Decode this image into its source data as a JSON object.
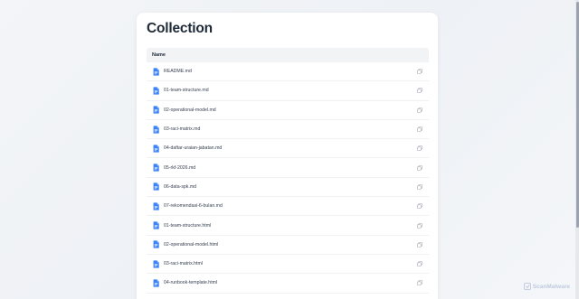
{
  "page": {
    "title": "Collection"
  },
  "table": {
    "header": "Name",
    "files": [
      "README.md",
      "01-team-structure.md",
      "02-operational-model.md",
      "03-raci-matrix.md",
      "04-daftar-uraian-jabatan.md",
      "05-rkf-2026.md",
      "06-data-spk.md",
      "07-rekomendasi-6-bulan.md",
      "01-team-structure.html",
      "02-operational-model.html",
      "03-raci-matrix.html",
      "04-runbook-template.html"
    ]
  },
  "watermark": {
    "text": "ScanMalware"
  },
  "colors": {
    "file_icon": "#3b82f6",
    "copy_icon": "#9ca3af",
    "title": "#1f2a37"
  },
  "icons": {
    "file": "document-icon",
    "copy": "copy-icon"
  }
}
